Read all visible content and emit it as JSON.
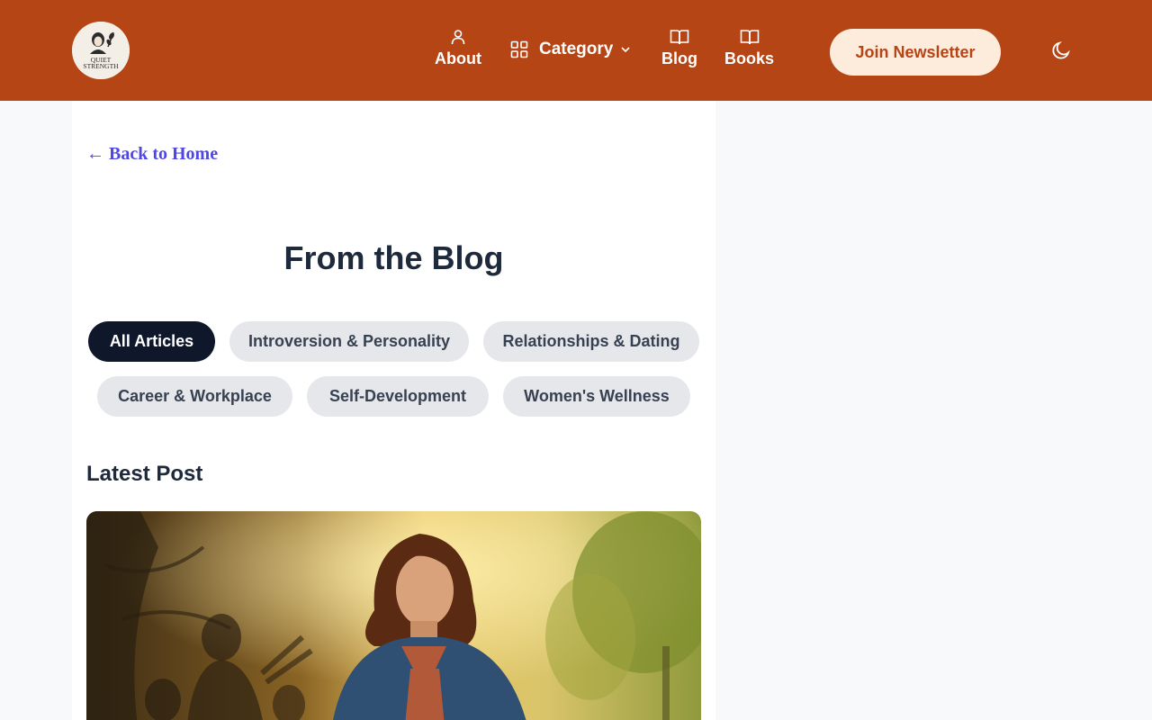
{
  "header": {
    "logo_text_line1": "QUIET",
    "logo_text_line2": "STRENGTH",
    "nav": {
      "about": "About",
      "category": "Category",
      "blog": "Blog",
      "books": "Books"
    },
    "newsletter_label": "Join Newsletter",
    "theme_toggle_icon": "moon-icon"
  },
  "main": {
    "back_link": "← Back to Home",
    "title": "From the Blog",
    "filters": [
      "All Articles",
      "Introversion & Personality",
      "Relationships & Dating",
      "Career & Workplace",
      "Self-Development",
      "Women's Wellness"
    ],
    "active_filter": "All Articles",
    "latest_heading": "Latest Post"
  },
  "colors": {
    "header_bg": "#b64516",
    "newsletter_bg": "#fdebdc",
    "active_pill": "#0f172a",
    "link": "#4f46e5"
  }
}
